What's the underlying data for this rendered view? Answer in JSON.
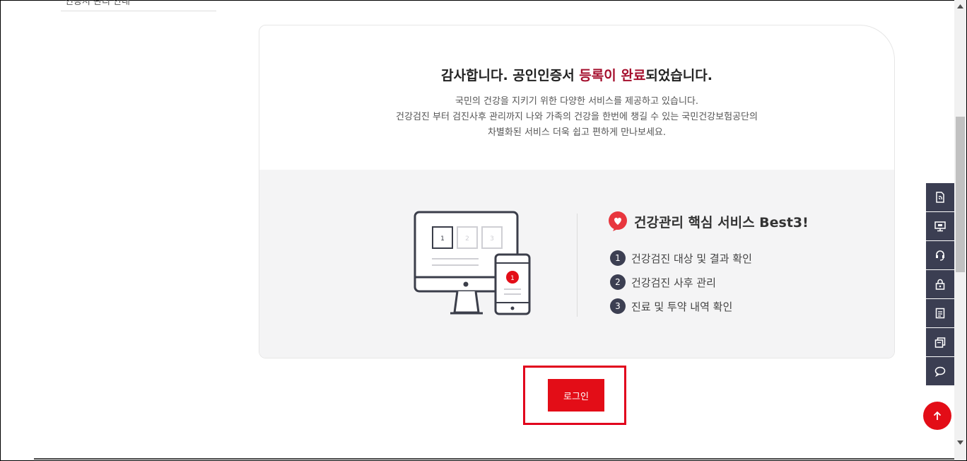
{
  "left_nav": {
    "partial_item": "인증서 관리 안내"
  },
  "card": {
    "title_prefix": "감사합니다. 공인인증서 ",
    "title_highlight": "등록이 완료",
    "title_suffix": "되었습니다.",
    "description": [
      "국민의 건강을 지키기 위한 다양한 서비스를 제공하고 있습니다.",
      "건강검진 부터 검진사후 관리까지 나와 가족의 건강을 한번에 챙길 수 있는 국민건강보험공단의",
      "차별화된 서비스 더욱 쉽고 편하게 만나보세요."
    ],
    "highlight_color": "#a50f2d"
  },
  "illustration": {
    "monitor_boxes": [
      "1",
      "2",
      "3"
    ],
    "phone_badge": "1"
  },
  "best": {
    "title": "건강관리 핵심 서비스 Best3!",
    "items": [
      {
        "num": "1",
        "label": "건강검진 대상 및 결과 확인"
      },
      {
        "num": "2",
        "label": "건강검진 사후 관리"
      },
      {
        "num": "3",
        "label": "진료 및 투약 내역 확인"
      }
    ]
  },
  "login_button": {
    "label": "로그인",
    "color": "#e30d17"
  },
  "quick_menu": {
    "icons": [
      "document-icon",
      "monitor-icon",
      "headset-icon",
      "lock-icon",
      "list-icon",
      "copy-icon",
      "chat-icon"
    ],
    "color": "#3b3e52"
  },
  "top_button": {
    "icon": "arrow-up-icon"
  }
}
